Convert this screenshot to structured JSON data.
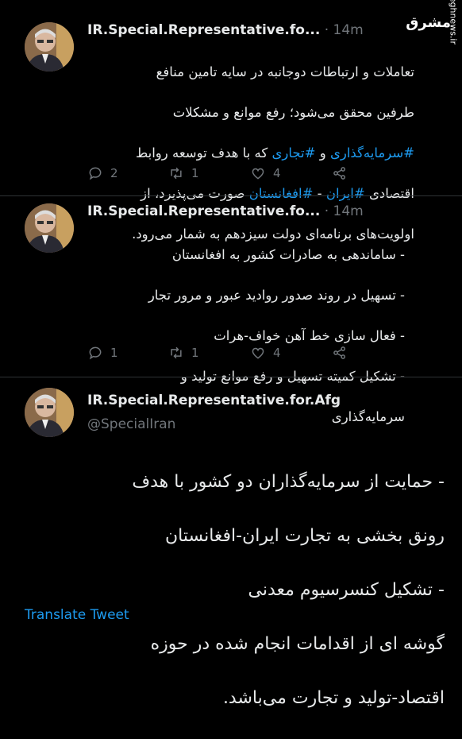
{
  "watermark": {
    "logo": "مشرق",
    "site": "mashreghnews.ir"
  },
  "tweets": [
    {
      "name": "IR.Special.Representative.fo...",
      "dot": "·",
      "time": "14m",
      "lines": [
        {
          "t": "تعاملات و ارتباطات دوجانبه در سایه تامین منافع"
        },
        {
          "t": "طرفین محقق می‌شود؛ رفع موانع و مشکلات"
        },
        {
          "pre": "",
          "tag1": "#سرمایه‌گذاری",
          "mid": " و ",
          "tag2": "#تجاری",
          "post": " که با هدف توسعه روابط"
        },
        {
          "pre": "اقتصادی ",
          "tag1": "#ایران",
          "mid": " - ",
          "tag2": "#افغانستان",
          "post": " صورت می‌پذیرد، از"
        },
        {
          "t": "اولویت‌های برنامه‌ای دولت سیزدهم به شمار می‌رود."
        }
      ],
      "replies": "2",
      "retweets": "1",
      "likes": "4"
    },
    {
      "name": "IR.Special.Representative.fo...",
      "dot": "·",
      "time": "14m",
      "lines": [
        {
          "t": "- ساماندهی به صادرات کشور به افغانستان"
        },
        {
          "t": "- تسهیل در روند صدور روادید عبور و مرور تجار"
        },
        {
          "t": "- فعال سازی خط آهن خواف-هرات"
        },
        {
          "t": "- تشکیل کمیته تسهیل و رفع موانع تولید و"
        },
        {
          "t": "سرمایه‌گذاری"
        }
      ],
      "replies": "1",
      "retweets": "1",
      "likes": "4"
    },
    {
      "name": "IR.Special.Representative.for.Afg",
      "handle": "@SpecialIran",
      "lines": [
        {
          "t": "- حمایت از سرمایه‌گذاران دو کشور با هدف"
        },
        {
          "t": "رونق بخشی به تجارت ایران-افغانستان"
        },
        {
          "t": "- تشکیل کنسرسیوم معدنی"
        },
        {
          "t": "گوشه ای از اقدامات انجام شده در حوزه"
        },
        {
          "t": "اقتصاد-تولید و تجارت می‌باشد."
        }
      ],
      "translate": "Translate Tweet"
    }
  ],
  "colors": {
    "background": "#000000",
    "text": "#e7e9ea",
    "muted": "#71767b",
    "link": "#1d9bf0",
    "separator": "#2f3336"
  },
  "icons": [
    "reply-icon",
    "retweet-icon",
    "like-icon",
    "share-icon"
  ]
}
